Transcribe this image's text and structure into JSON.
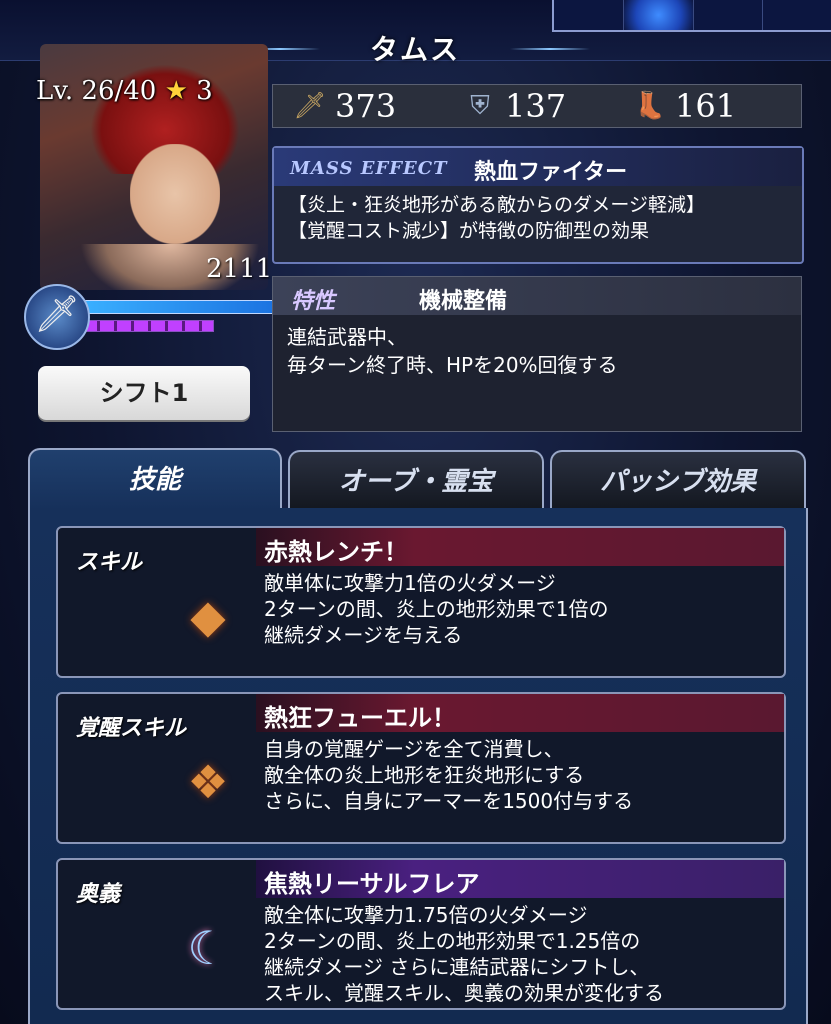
{
  "character": {
    "name": "タムス",
    "level_text": "Lv. 26/40",
    "stars": "3",
    "power": "2111",
    "shift_label": "シフト1"
  },
  "stats": {
    "attack": "373",
    "defense": "137",
    "speed": "161",
    "icons": [
      "sword-icon",
      "shield-icon",
      "boot-icon"
    ]
  },
  "mass_effect": {
    "label": "MASS EFFECT",
    "name": "熱血ファイター",
    "desc_line1": "【炎上・狂炎地形がある敵からのダメージ軽減】",
    "desc_line2": "【覚醒コスト減少】が特徴の防御型の効果"
  },
  "trait": {
    "label": "特性",
    "name": "機械整備",
    "desc_line1": "連結武器中、",
    "desc_line2": "毎ターン終了時、HPを20%回復する"
  },
  "tabs": {
    "skills": "技能",
    "orbs": "オーブ・霊宝",
    "passive": "パッシブ効果"
  },
  "skills": [
    {
      "type": "スキル",
      "name": "赤熱レンチ！",
      "lines": [
        "敵単体に攻撃力1倍の火ダメージ",
        "2ターンの間、炎上の地形効果で1倍の",
        "継続ダメージを与える"
      ]
    },
    {
      "type": "覚醒スキル",
      "name": "熱狂フューエル！",
      "lines": [
        "自身の覚醒ゲージを全て消費し、",
        "敵全体の炎上地形を狂炎地形にする",
        "さらに、自身にアーマーを1500付与する"
      ]
    },
    {
      "type": "奥義",
      "name": "焦熱リーサルフレア",
      "lines": [
        "敵全体に攻撃力1.75倍の火ダメージ",
        "2ターンの間、炎上の地形効果で1.25倍の",
        "継続ダメージ さらに連結武器にシフトし、",
        "スキル、覚醒スキル、奥義の効果が変化する"
      ]
    }
  ]
}
